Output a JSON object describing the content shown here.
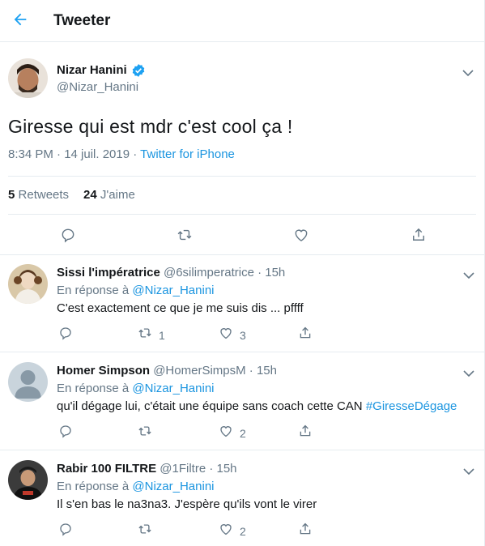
{
  "header": {
    "title": "Tweeter"
  },
  "tweet": {
    "author_name": "Nizar Hanini",
    "author_handle": "@Nizar_Hanini",
    "text": "Giresse qui est mdr c'est cool ça !",
    "time": "8:34 PM · 14 juil. 2019 · ",
    "source": "Twitter for iPhone",
    "retweets_count": "5",
    "retweets_label": "Retweets",
    "likes_count": "24",
    "likes_label": "J'aime"
  },
  "replies": [
    {
      "name": "Sissi l'impératrice",
      "handle": "@6silimperatrice · 15h",
      "in_reply_prefix": "En réponse à ",
      "mention": "@Nizar_Hanini",
      "text": "C'est exactement ce que je me suis dis ... pffff",
      "hashtag": "",
      "retweets": "1",
      "likes": "3"
    },
    {
      "name": "Homer Simpson",
      "handle": "@HomerSimpsM · 15h",
      "in_reply_prefix": "En réponse à ",
      "mention": "@Nizar_Hanini",
      "text": "qu'il dégage lui, c'était une équipe sans coach cette CAN ",
      "hashtag": "#GiresseDégage",
      "retweets": "",
      "likes": "2"
    },
    {
      "name": "Rabir 100 FILTRE",
      "handle": "@1Filtre · 15h",
      "in_reply_prefix": "En réponse à ",
      "mention": "@Nizar_Hanini",
      "text": "Il s'en bas le na3na3. J'espère qu'ils vont le virer",
      "hashtag": "",
      "retweets": "",
      "likes": "2"
    }
  ],
  "colors": {
    "accent": "#1da1f2",
    "link": "#1b95e0",
    "secondary_text": "#657786",
    "divider": "#e6ecf0"
  },
  "icons": [
    "back-arrow-icon",
    "verified-badge-icon",
    "chevron-down-icon",
    "reply-icon",
    "retweet-icon",
    "like-icon",
    "share-icon"
  ]
}
